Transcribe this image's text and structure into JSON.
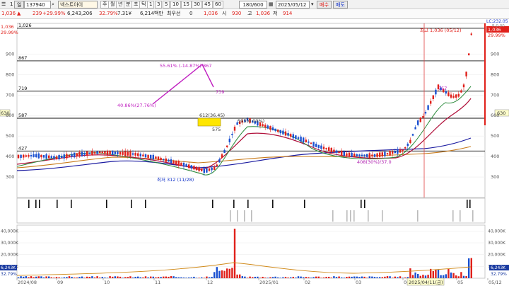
{
  "toolbar": {
    "menu_icon": "menu-icon",
    "first_label": "1",
    "tab_label": "일",
    "code": "137940",
    "search_icon": "search-icon",
    "name": "넥스트아이",
    "periods": [
      "주",
      "월",
      "년",
      "분",
      "초",
      "틱",
      "1",
      "3",
      "5",
      "10",
      "15",
      "30",
      "45",
      "60"
    ],
    "count": "180/600",
    "date": "2025/05/12",
    "buy_label": "매수",
    "sell_label": "매도"
  },
  "quote": {
    "price": "1,036",
    "change": "239",
    "change_pct": "+29.99%",
    "volume": "6,243,206",
    "vol_ratio": "32.79%",
    "vol_unit": "7.31¥",
    "amount": "6,214백만",
    "label_prior": "최우선",
    "prior_val": "0",
    "open_val": "1,036",
    "label_open": "시",
    "open2": "930",
    "label_high": "고",
    "high": "1,036",
    "label_low": "저",
    "low": "914"
  },
  "chart_data": {
    "type": "candlestick",
    "x_ticks": [
      "2024/08",
      "09",
      "10",
      "11",
      "12",
      "2025/01",
      "02",
      "03",
      "04",
      "05",
      "05/12"
    ],
    "y_ticks": [
      300,
      400,
      500,
      600,
      700,
      800,
      900
    ],
    "ylim": [
      200,
      1050
    ],
    "horizontal_levels": [
      {
        "value": 1026,
        "label": "1,026"
      },
      {
        "value": 867,
        "label": "867"
      },
      {
        "value": 719,
        "label": "719"
      },
      {
        "value": 587,
        "label": "587"
      },
      {
        "value": 427,
        "label": "427"
      }
    ],
    "right_labels": [
      "1,036",
      "29.99%",
      "LC:232.05",
      "R:0.00",
      "630"
    ],
    "left_labels": [
      "1,036",
      "29.99%",
      "630"
    ],
    "annotations": [
      "최고 1,036 (05/12)",
      "55.61% (-14.87%) 867",
      "739",
      "40.86%(27.76%)",
      "612(36.45)",
      "575",
      "최저 312 (11/28)",
      "757",
      "593(0.00%)",
      "408(30%)/37.0"
    ],
    "volume_ticks": [
      "40,000K",
      "30,000K",
      "20,000K",
      "10,000K"
    ],
    "volume_right_labels": [
      "6,243K",
      "32.79%"
    ],
    "volume_left_labels": [
      "6,243K",
      "32.79%"
    ],
    "cursor_date": "2025/04/11(금)"
  }
}
